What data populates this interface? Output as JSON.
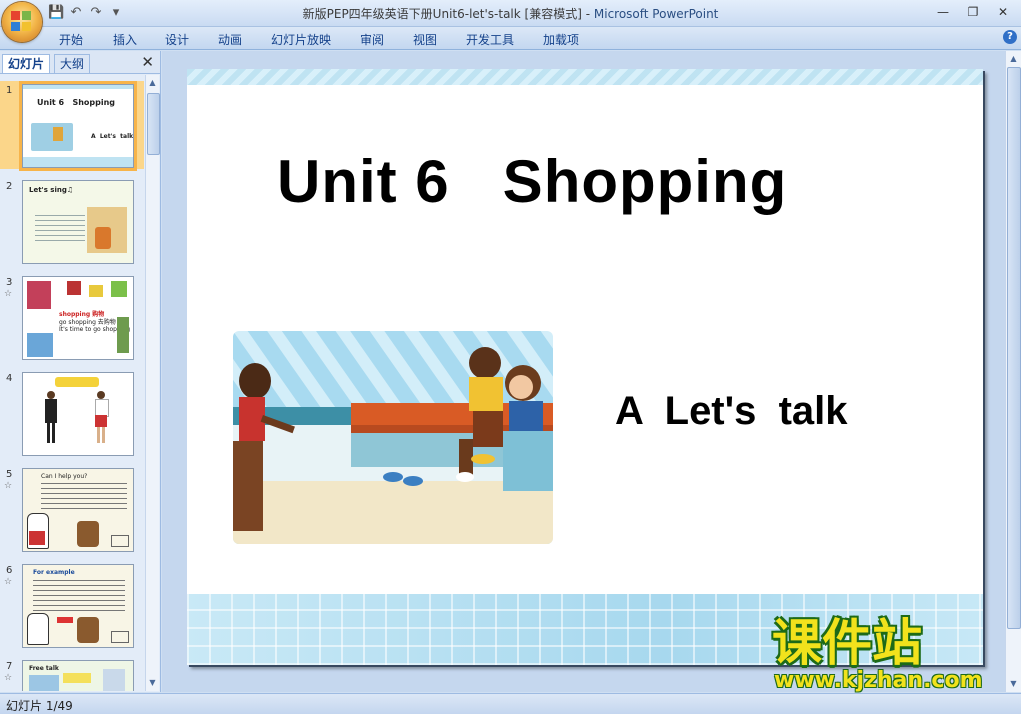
{
  "window": {
    "title": "新版PEP四年级英语下册Unit6-let's-talk [兼容模式]",
    "separator": " - ",
    "app_name": "Microsoft PowerPoint"
  },
  "ribbon": {
    "tabs": [
      "开始",
      "插入",
      "设计",
      "动画",
      "幻灯片放映",
      "审阅",
      "视图",
      "开发工具",
      "加载项"
    ]
  },
  "panel": {
    "tab_slides": "幻灯片",
    "tab_outline": "大纲",
    "thumbnails": [
      {
        "num": "1",
        "star": "",
        "lines": [
          "Unit 6   Shopping",
          "A  Let's  talk"
        ]
      },
      {
        "num": "2",
        "star": "☆",
        "lines": [
          "Let's sing♫"
        ]
      },
      {
        "num": "3",
        "star": "☆",
        "lines": [
          "shopping 购物",
          "go shopping 去购物",
          "It's time to go shopping"
        ]
      },
      {
        "num": "4",
        "star": "",
        "lines": [
          ""
        ]
      },
      {
        "num": "5",
        "star": "☆",
        "lines": [
          "Can I help you?"
        ]
      },
      {
        "num": "6",
        "star": "☆",
        "lines": [
          "For example"
        ]
      },
      {
        "num": "7",
        "star": "☆",
        "lines": [
          "Free talk"
        ]
      }
    ]
  },
  "slide": {
    "title": "Unit 6   Shopping",
    "subtitle": "A  Let's  talk"
  },
  "watermark": {
    "cn": "课件站",
    "url": "www.kjzhan.com"
  },
  "status": {
    "slide_counter": "幻灯片 1/49"
  },
  "colors": {
    "accent_tab": "#15428b",
    "selected_thumb": "#f7b44a",
    "watermark_fill": "#f2e21c",
    "watermark_stroke": "#1d6a18"
  }
}
